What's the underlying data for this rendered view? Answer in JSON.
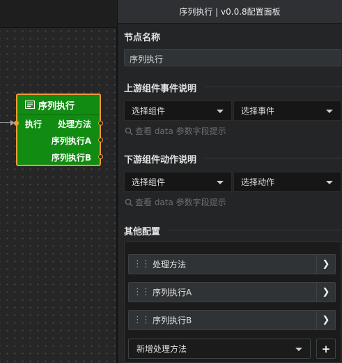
{
  "canvas": {
    "node": {
      "title": "序列执行",
      "input_port_label": "执行",
      "output_ports": [
        "处理方法",
        "序列执行A",
        "序列执行B"
      ]
    }
  },
  "panel": {
    "title": "序列执行 | v0.0.8配置面板",
    "node_name_label": "节点名称",
    "node_name_value": "序列执行",
    "upstream": {
      "label": "上游组件事件说明",
      "component_select": "选择组件",
      "event_select": "选择事件",
      "hint": "查看 data 参数字段提示"
    },
    "downstream": {
      "label": "下游组件动作说明",
      "component_select": "选择组件",
      "action_select": "选择动作",
      "hint": "查看 data 参数字段提示"
    },
    "other": {
      "label": "其他配置",
      "methods": [
        "处理方法",
        "序列执行A",
        "序列执行B"
      ],
      "add_method_placeholder": "新增处理方法",
      "add_button": "+"
    }
  },
  "colors": {
    "node_fill": "#128b12",
    "node_border": "#f29c38",
    "panel_bg": "#242526"
  }
}
